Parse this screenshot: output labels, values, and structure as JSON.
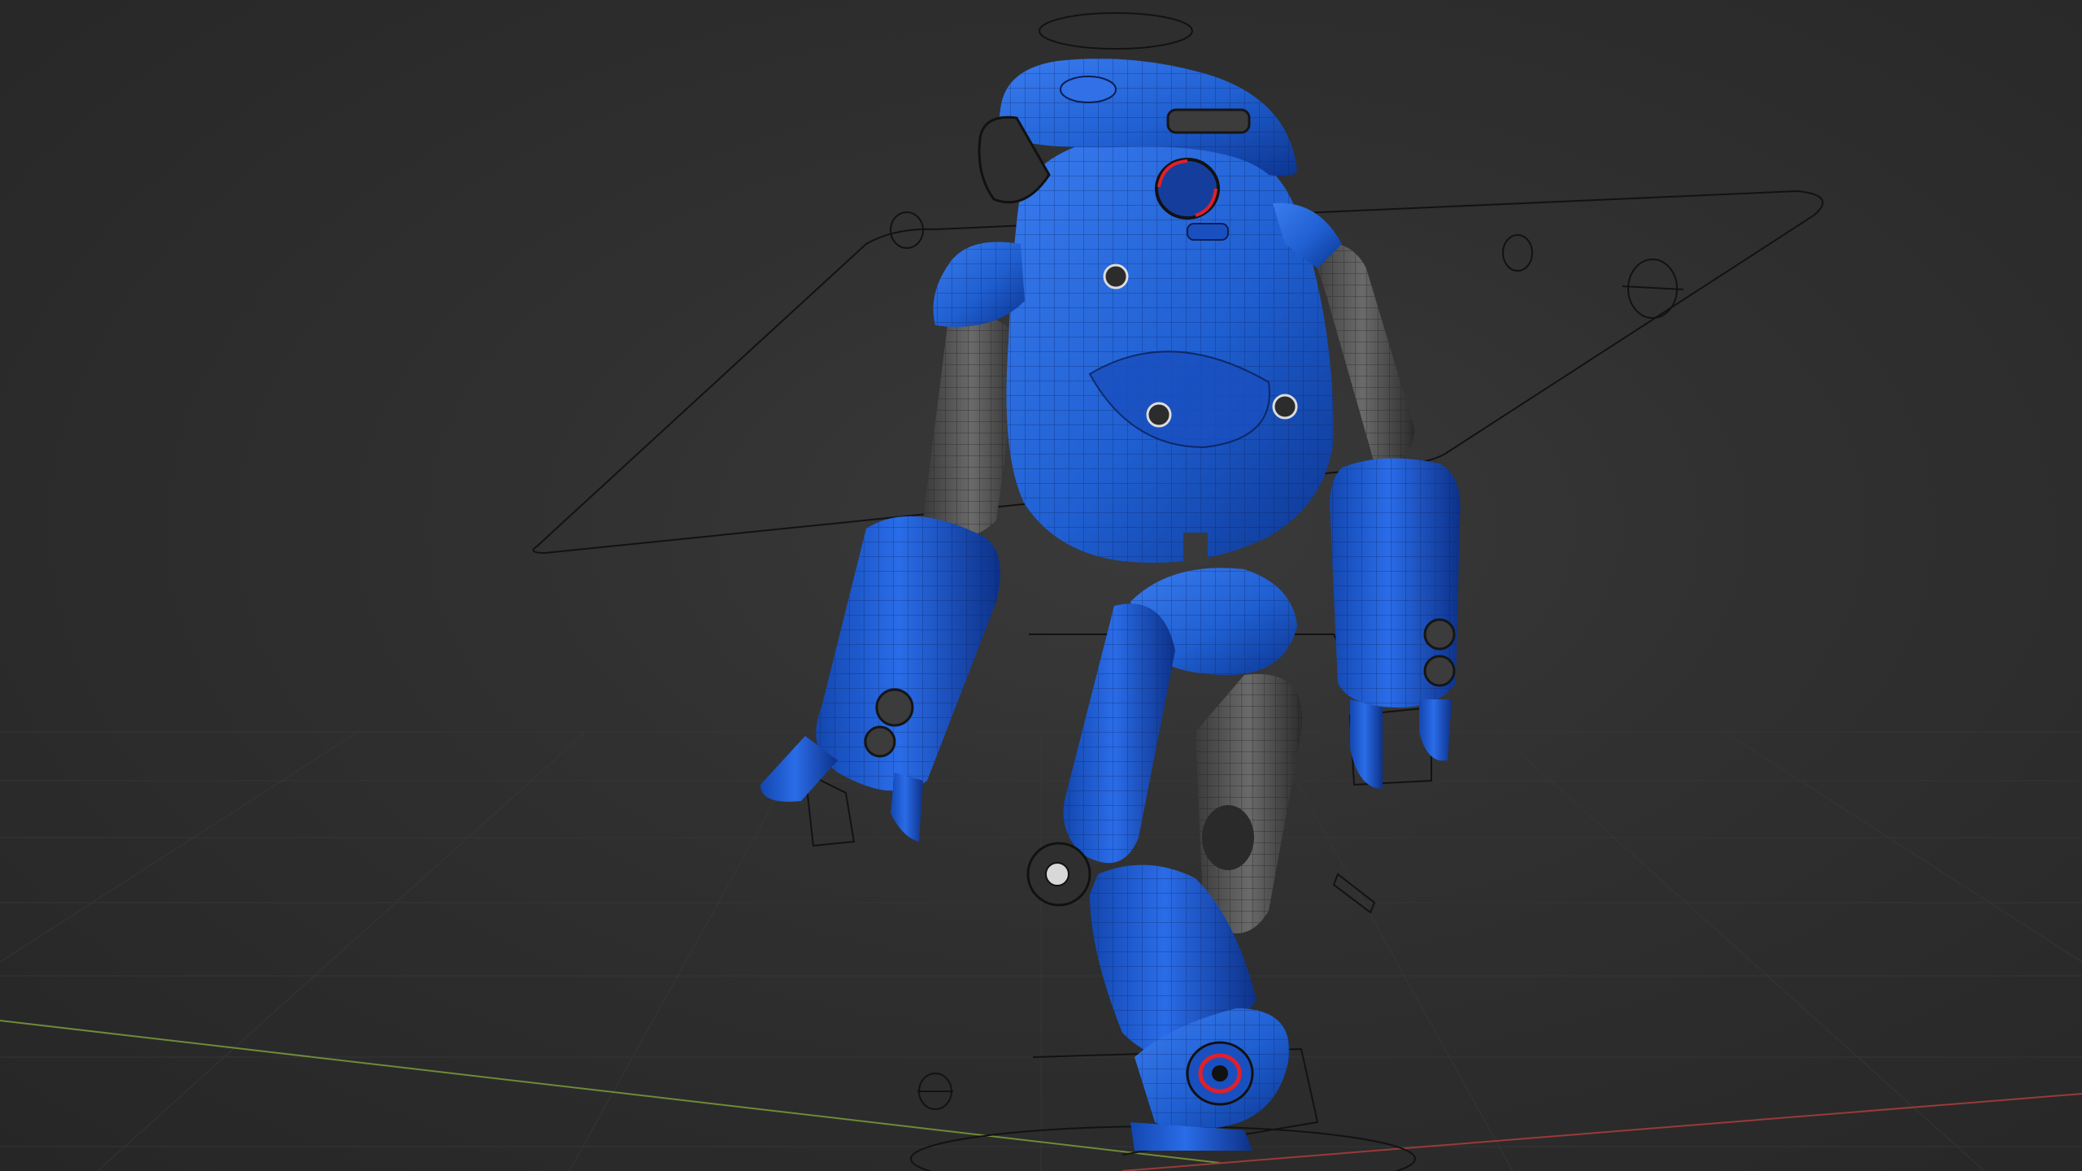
{
  "viewport": {
    "name": "3D Viewport",
    "shading_mode": "solid-wireframe-overlay",
    "overlays": {
      "grid_floor": true,
      "x_axis": true,
      "y_axis": true,
      "rig_controls": true
    }
  },
  "scene_object": {
    "name": "robot",
    "primary_color": "#1f5fd1",
    "secondary_color": "#4a4a4a",
    "accent_color": "#e0202a"
  },
  "colors": {
    "background": "#2b2b2b",
    "grid": "#3a3a3a",
    "x_axis": "#9a3a3a",
    "y_axis": "#6f8a3a",
    "rig_lines": "#111111",
    "wire": "#0b1e52"
  }
}
